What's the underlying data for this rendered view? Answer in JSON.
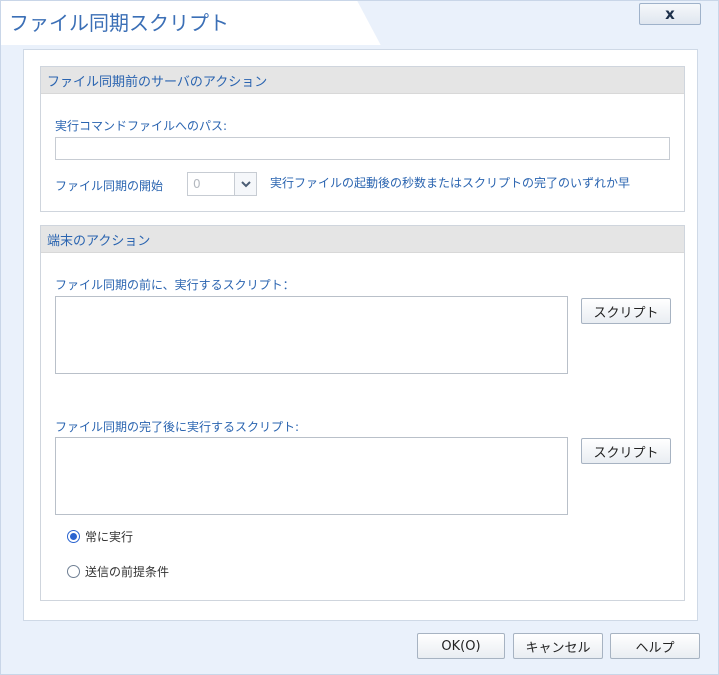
{
  "window": {
    "title": "ファイル同期スクリプト",
    "close_label": "x"
  },
  "server_section": {
    "header": "ファイル同期前のサーバのアクション",
    "path_label": "実行コマンドファイルへのパス:",
    "path_value": "",
    "start_label": "ファイル同期の開始",
    "start_value": "0",
    "start_description": "実行ファイルの起動後の秒数またはスクリプトの完了のいずれか早"
  },
  "client_section": {
    "header": "端末のアクション",
    "before_label": "ファイル同期の前に、実行するスクリプト：",
    "before_script_button": "スクリプト",
    "after_label": "ファイル同期の完了後に実行するスクリプト:",
    "after_script_button": "スクリプト",
    "radio_options": [
      {
        "label": "常に実行",
        "checked": true
      },
      {
        "label": "送信の前提条件",
        "checked": false
      }
    ]
  },
  "footer": {
    "ok_label": "OK(O)",
    "cancel_label": "キャンセル",
    "help_label": "ヘルプ"
  },
  "colors": {
    "accent": "#2a64b0",
    "radio_selected": "#2a64d0",
    "background": "#eaf1fb"
  }
}
